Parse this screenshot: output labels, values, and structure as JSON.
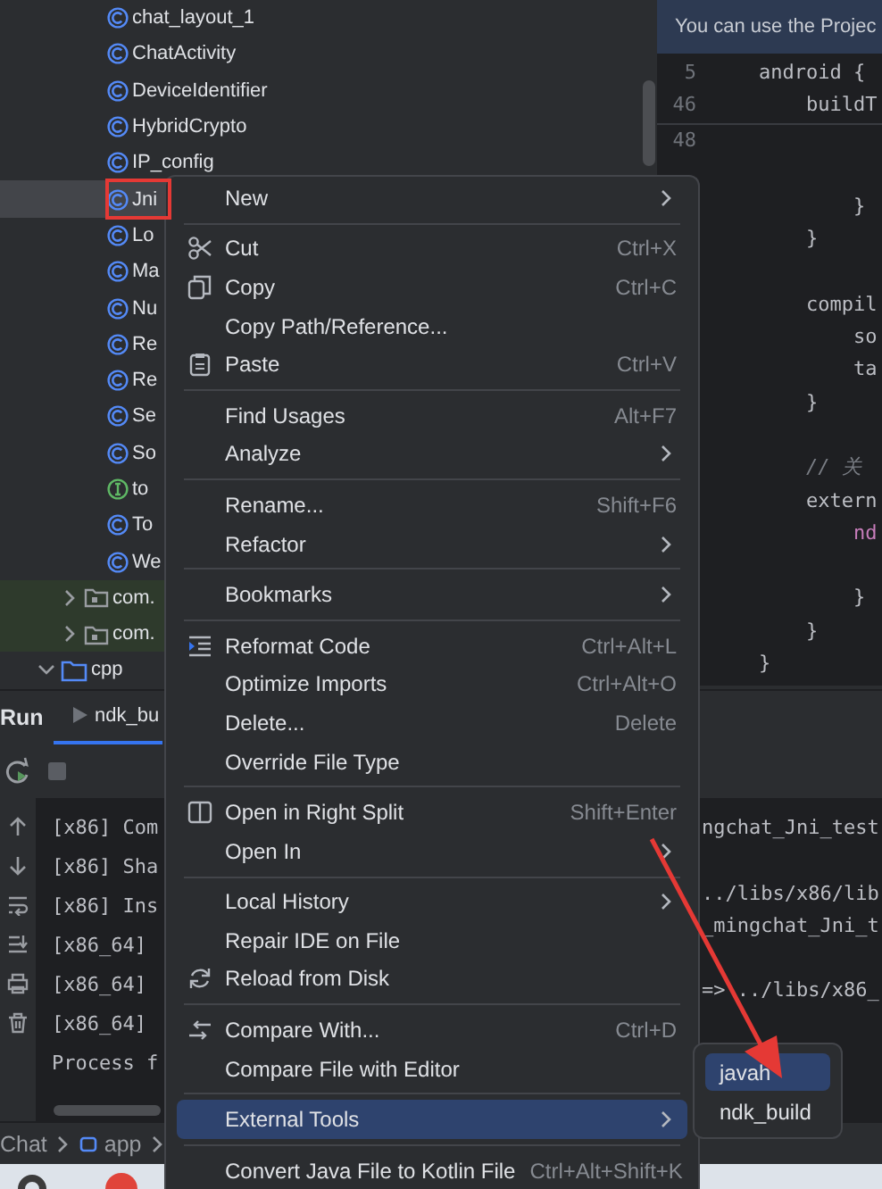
{
  "project_tree": {
    "items": [
      {
        "name": "chat_layout_1",
        "kind": "class",
        "selected": false
      },
      {
        "name": "ChatActivity",
        "kind": "class",
        "selected": false
      },
      {
        "name": "DeviceIdentifier",
        "kind": "class",
        "selected": false
      },
      {
        "name": "HybridCrypto",
        "kind": "class",
        "selected": false
      },
      {
        "name": "IP_config",
        "kind": "class",
        "selected": false
      },
      {
        "name": "Jni",
        "kind": "class",
        "selected": true
      },
      {
        "name": "Lo",
        "kind": "class",
        "selected": false
      },
      {
        "name": "Ma",
        "kind": "class",
        "selected": false
      },
      {
        "name": "Nu",
        "kind": "class",
        "selected": false
      },
      {
        "name": "Re",
        "kind": "class",
        "selected": false
      },
      {
        "name": "Re",
        "kind": "class",
        "selected": false
      },
      {
        "name": "Se",
        "kind": "class",
        "selected": false
      },
      {
        "name": "So",
        "kind": "class",
        "selected": false
      },
      {
        "name": "to",
        "kind": "interface",
        "selected": false
      },
      {
        "name": "To",
        "kind": "class",
        "selected": false
      },
      {
        "name": "We",
        "kind": "class",
        "selected": false
      },
      {
        "name": "com.",
        "kind": "package",
        "expanded": false,
        "selected": false
      },
      {
        "name": "com.",
        "kind": "package",
        "expanded": false,
        "selected": false
      },
      {
        "name": "cpp",
        "kind": "folder",
        "expanded": true,
        "selected": false
      }
    ]
  },
  "editor": {
    "banner": "You can use the Projec",
    "sticky_lines": [
      {
        "number": "5",
        "text": "android {"
      },
      {
        "number": "46",
        "text": "    buildT"
      }
    ],
    "lines": [
      {
        "kind": "blank",
        "number": "48"
      },
      {
        "kind": "blank"
      },
      {
        "kind": "code",
        "text": "        }"
      },
      {
        "kind": "code",
        "text": "    }"
      },
      {
        "kind": "blank"
      },
      {
        "kind": "code",
        "text": "    compil"
      },
      {
        "kind": "code",
        "text": "        so"
      },
      {
        "kind": "code",
        "text": "        ta"
      },
      {
        "kind": "code",
        "text": "    }"
      },
      {
        "kind": "blank"
      },
      {
        "kind": "comment",
        "text": "    // 关"
      },
      {
        "kind": "code",
        "text": "    extern"
      },
      {
        "kind": "property",
        "text": "        nd"
      },
      {
        "kind": "blank"
      },
      {
        "kind": "code",
        "text": "        }"
      },
      {
        "kind": "code",
        "text": "    }"
      },
      {
        "kind": "code",
        "text": "}"
      }
    ]
  },
  "run_panel": {
    "title": "Run",
    "tabs": [
      {
        "label": "ndk_bu",
        "selected": true
      }
    ],
    "console_left": [
      "[x86] Com",
      "[x86] Sha",
      "[x86] Ins",
      "[x86_64]",
      "[x86_64]",
      "[x86_64]",
      "Process f"
    ],
    "console_right": [
      "ngchat_Jni_test",
      "../libs/x86/lib",
      "_mingchat_Jni_t",
      "=> ../libs/x86_"
    ]
  },
  "breadcrumb": [
    "Chat",
    "app"
  ],
  "context_menu": {
    "groups": [
      [
        {
          "label": "New",
          "submenu": true,
          "selected": false
        }
      ],
      [
        {
          "label": "Cut",
          "shortcut": "Ctrl+X",
          "selected": false
        },
        {
          "label": "Copy",
          "shortcut": "Ctrl+C",
          "selected": false
        },
        {
          "label": "Copy Path/Reference...",
          "selected": false
        },
        {
          "label": "Paste",
          "shortcut": "Ctrl+V",
          "selected": false
        }
      ],
      [
        {
          "label": "Find Usages",
          "shortcut": "Alt+F7",
          "selected": false
        },
        {
          "label": "Analyze",
          "submenu": true,
          "selected": false
        }
      ],
      [
        {
          "label": "Rename...",
          "shortcut": "Shift+F6",
          "selected": false
        },
        {
          "label": "Refactor",
          "submenu": true,
          "selected": false
        }
      ],
      [
        {
          "label": "Bookmarks",
          "submenu": true,
          "selected": false
        }
      ],
      [
        {
          "label": "Reformat Code",
          "shortcut": "Ctrl+Alt+L",
          "selected": false
        },
        {
          "label": "Optimize Imports",
          "shortcut": "Ctrl+Alt+O",
          "selected": false
        },
        {
          "label": "Delete...",
          "shortcut": "Delete",
          "selected": false
        },
        {
          "label": "Override File Type",
          "selected": false
        }
      ],
      [
        {
          "label": "Open in Right Split",
          "shortcut": "Shift+Enter",
          "selected": false
        },
        {
          "label": "Open In",
          "submenu": true,
          "selected": false
        }
      ],
      [
        {
          "label": "Local History",
          "submenu": true,
          "selected": false
        },
        {
          "label": "Repair IDE on File",
          "selected": false
        },
        {
          "label": "Reload from Disk",
          "selected": false
        }
      ],
      [
        {
          "label": "Compare With...",
          "shortcut": "Ctrl+D",
          "selected": false
        },
        {
          "label": "Compare File with Editor",
          "selected": false
        }
      ],
      [
        {
          "label": "External Tools",
          "submenu": true,
          "selected": true
        }
      ],
      [
        {
          "label": "Convert Java File to Kotlin File",
          "shortcut": "Ctrl+Alt+Shift+K",
          "selected": false
        }
      ]
    ]
  },
  "external_tools_submenu": {
    "items": [
      {
        "label": "javah",
        "selected": true
      },
      {
        "label": "ndk_build",
        "selected": false
      }
    ]
  }
}
